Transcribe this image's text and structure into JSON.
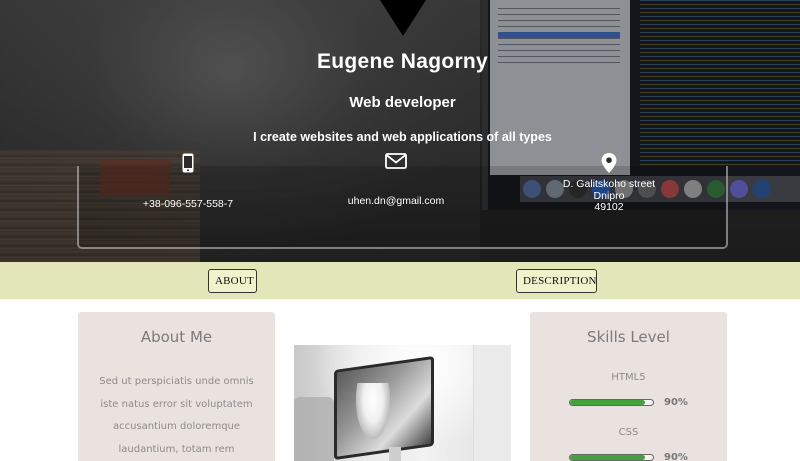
{
  "header": {
    "name": "Eugene Nagorny",
    "role": "Web developer",
    "tagline": "I create websites and web applications of all types"
  },
  "contacts": {
    "phone": {
      "icon": "phone-icon",
      "value": "+38-096-557-558-7"
    },
    "email": {
      "icon": "envelope-icon",
      "value": "uhen.dn@gmail.com"
    },
    "address": {
      "icon": "map-pin-icon",
      "street": "D. Galitskoho street",
      "city": "Dnipro",
      "zip": "49102"
    }
  },
  "nav": {
    "about_label": "ABOUT",
    "description_label": "DESCRIPTION"
  },
  "about": {
    "title": "About Me",
    "text": "Sed ut perspiciatis unde omnis iste natus error sit voluptatem accusantium doloremque laudantium, totam rem"
  },
  "skills": {
    "title": "Skills Level",
    "items": [
      {
        "name": "HTML5",
        "percent": "90%",
        "level": 0.9
      },
      {
        "name": "CSS",
        "percent": "90%",
        "level": 0.9
      }
    ]
  },
  "colors": {
    "nav_strip": "#e3e6b8",
    "card_bg": "#e9e2df",
    "skill_fill": "#43a33a",
    "hero_text": "#ffffff"
  }
}
